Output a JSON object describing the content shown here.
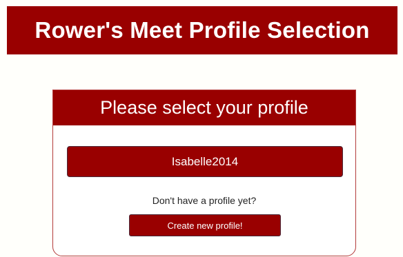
{
  "header": {
    "title": "Rower's Meet Profile Selection"
  },
  "card": {
    "title": "Please select your profile",
    "profiles": [
      {
        "name": "Isabelle2014"
      }
    ],
    "no_profile_text": "Don't have a profile yet?",
    "create_button_label": "Create new profile!"
  },
  "colors": {
    "primary": "#990000",
    "background": "#fffffb",
    "text": "#222222"
  }
}
